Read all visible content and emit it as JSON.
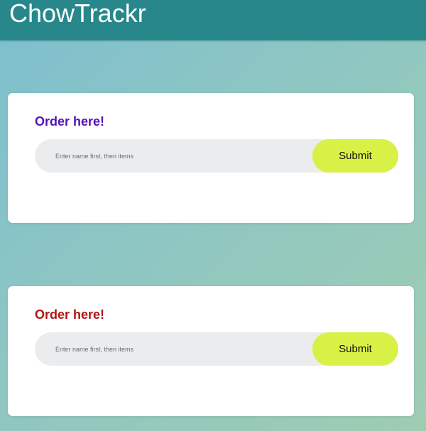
{
  "header": {
    "title": "ChowTrackr"
  },
  "cards": [
    {
      "heading": "Order here!",
      "heading_color": "#5112b8",
      "input_placeholder": "Enter name first, then items",
      "input_value": "",
      "submit_label": "Submit"
    },
    {
      "heading": "Order here!",
      "heading_color": "#b31313",
      "input_placeholder": "Enter name first, then items",
      "input_value": "",
      "submit_label": "Submit"
    }
  ],
  "colors": {
    "header_bg": "#27878b",
    "submit_bg": "#d8f146",
    "input_bg": "#ebecee"
  }
}
